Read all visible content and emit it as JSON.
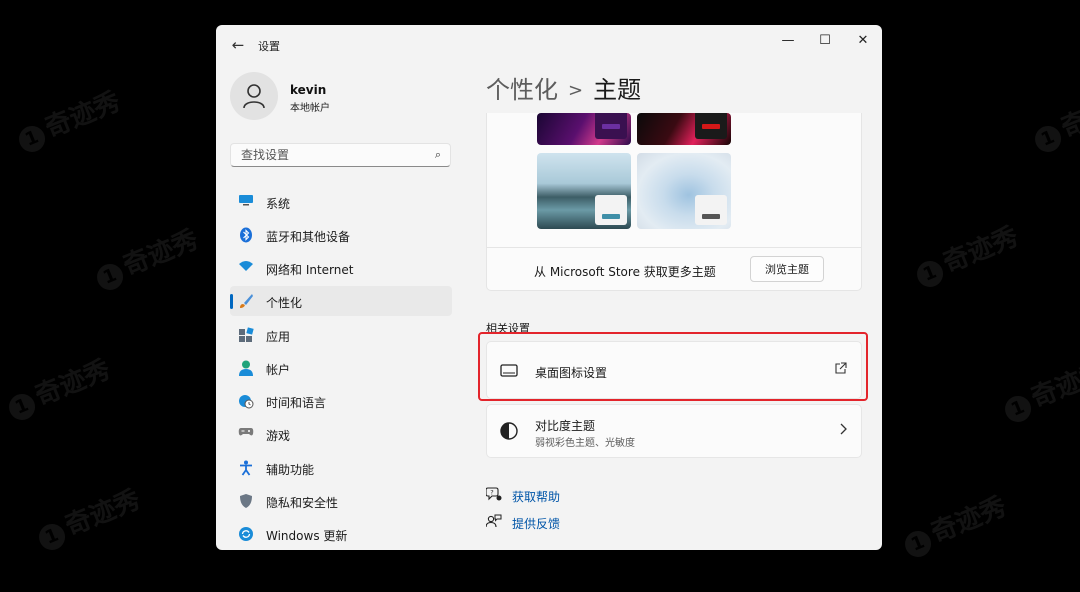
{
  "watermark": "奇迹秀",
  "window": {
    "back_icon": "←",
    "app_title": "设置",
    "controls": {
      "minimize": "—",
      "maximize": "☐",
      "close": "✕"
    }
  },
  "user": {
    "name": "kevin",
    "account_type": "本地帐户"
  },
  "search": {
    "placeholder": "查找设置",
    "icon": "⌕"
  },
  "sidebar": {
    "items": [
      {
        "label": "系统",
        "icon": "system-icon",
        "color": "#1a8cd8"
      },
      {
        "label": "蓝牙和其他设备",
        "icon": "bluetooth-icon",
        "color": "#1a6fd8"
      },
      {
        "label": "网络和 Internet",
        "icon": "wifi-icon",
        "color": "#1a8cd8"
      },
      {
        "label": "个性化",
        "icon": "brush-icon",
        "color": "#d87a1a",
        "active": true
      },
      {
        "label": "应用",
        "icon": "apps-icon",
        "color": "#5d6b7a"
      },
      {
        "label": "帐户",
        "icon": "account-icon",
        "color": "#1fa37a"
      },
      {
        "label": "时间和语言",
        "icon": "globe-clock-icon",
        "color": "#1a8cd8"
      },
      {
        "label": "游戏",
        "icon": "gamepad-icon",
        "color": "#7a7a7a"
      },
      {
        "label": "辅助功能",
        "icon": "accessibility-icon",
        "color": "#1a6fd8"
      },
      {
        "label": "隐私和安全性",
        "icon": "shield-icon",
        "color": "#6b7785"
      },
      {
        "label": "Windows 更新",
        "icon": "update-icon",
        "color": "#1a8cd8"
      }
    ]
  },
  "page": {
    "parent": "个性化",
    "separator": ">",
    "title": "主题"
  },
  "themes": {
    "store_text": "从 Microsoft Store 获取更多主题",
    "browse_button": "浏览主题"
  },
  "related": {
    "section_label": "相关设置",
    "desktop_icons": {
      "title": "桌面图标设置",
      "icon": "monitor-icon",
      "action_icon": "external-link-icon"
    },
    "contrast": {
      "title": "对比度主题",
      "subtitle": "弱视彩色主题、光敏度",
      "icon": "contrast-icon",
      "action_icon": "chevron-right-icon"
    }
  },
  "help": {
    "get_help": "获取帮助",
    "feedback": "提供反馈"
  },
  "colors": {
    "accent": "#0067c0",
    "highlight": "#e3242b",
    "link": "#0055a8"
  }
}
